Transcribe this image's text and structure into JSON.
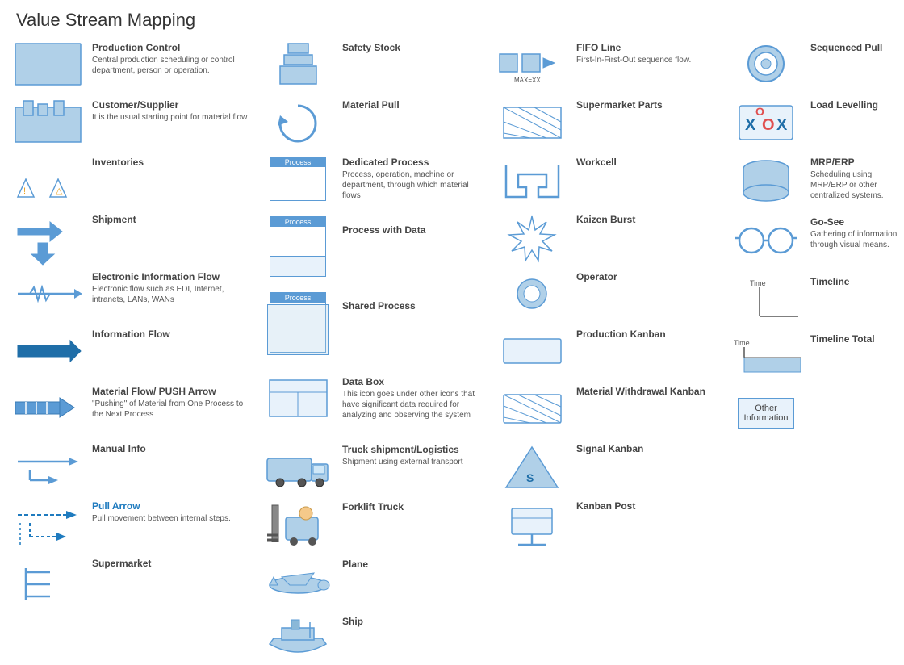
{
  "title": "Value Stream Mapping",
  "col1": {
    "items": [
      {
        "id": "production-control",
        "label": "Production Control",
        "desc": "Central production scheduling or control department, person or operation.",
        "icon": "production-control"
      },
      {
        "id": "customer-supplier",
        "label": "Customer/Supplier",
        "desc": "It is the usual starting point for material flow",
        "icon": "customer-supplier"
      },
      {
        "id": "inventories",
        "label": "Inventories",
        "desc": "",
        "icon": "inventories"
      },
      {
        "id": "shipment",
        "label": "Shipment",
        "desc": "",
        "icon": "shipment"
      },
      {
        "id": "electronic-info",
        "label": "Electronic Information Flow",
        "desc": "Electronic flow such as EDI, Internet, intranets, LANs, WANs",
        "icon": "electronic-info"
      },
      {
        "id": "information-flow",
        "label": "Information Flow",
        "desc": "",
        "icon": "information-flow"
      },
      {
        "id": "material-flow",
        "label": "Material Flow/ PUSH Arrow",
        "desc": "\"Pushing\" of Material from One Process to the Next Process",
        "icon": "material-flow"
      },
      {
        "id": "manual-info",
        "label": "Manual Info",
        "desc": "",
        "icon": "manual-info"
      },
      {
        "id": "pull-arrow",
        "label": "Pull Arrow",
        "desc": "Pull movement between internal steps.",
        "icon": "pull-arrow"
      },
      {
        "id": "supermarket",
        "label": "Supermarket",
        "desc": "",
        "icon": "supermarket"
      }
    ]
  },
  "col2": {
    "items": [
      {
        "id": "safety-stock",
        "label": "Safety Stock",
        "desc": "",
        "icon": "safety-stock"
      },
      {
        "id": "material-pull",
        "label": "Material Pull",
        "desc": "",
        "icon": "material-pull"
      },
      {
        "id": "dedicated-process",
        "label": "Dedicated Process",
        "desc": "Process, operation, machine or department, through which material flows",
        "icon": "dedicated-process"
      },
      {
        "id": "process-with-data",
        "label": "Process with Data",
        "desc": "",
        "icon": "process-with-data"
      },
      {
        "id": "shared-process",
        "label": "Shared Process",
        "desc": "",
        "icon": "shared-process"
      },
      {
        "id": "data-box",
        "label": "Data Box",
        "desc": "This icon goes under other icons that have significant data required for analyzing and observing the system",
        "icon": "data-box"
      },
      {
        "id": "truck-shipment",
        "label": "Truck shipment/Logistics",
        "desc": "Shipment using external transport",
        "icon": "truck"
      },
      {
        "id": "forklift",
        "label": "Forklift Truck",
        "desc": "",
        "icon": "forklift"
      },
      {
        "id": "plane",
        "label": "Plane",
        "desc": "",
        "icon": "plane"
      },
      {
        "id": "ship",
        "label": "Ship",
        "desc": "",
        "icon": "ship"
      }
    ]
  },
  "col3": {
    "items": [
      {
        "id": "fifo-line",
        "label": "FIFO Line",
        "desc": "First-In-First-Out sequence flow.",
        "sub": "MAX=XX",
        "icon": "fifo"
      },
      {
        "id": "supermarket-parts",
        "label": "Supermarket Parts",
        "desc": "",
        "icon": "supermarket-parts"
      },
      {
        "id": "workcell",
        "label": "Workcell",
        "desc": "",
        "icon": "workcell"
      },
      {
        "id": "kaizen-burst",
        "label": "Kaizen Burst",
        "desc": "",
        "icon": "kaizen-burst"
      },
      {
        "id": "operator",
        "label": "Operator",
        "desc": "",
        "icon": "operator"
      },
      {
        "id": "production-kanban",
        "label": "Production Kanban",
        "desc": "",
        "icon": "production-kanban"
      },
      {
        "id": "material-withdrawal",
        "label": "Material Withdrawal Kanban",
        "desc": "",
        "icon": "material-withdrawal"
      },
      {
        "id": "signal-kanban",
        "label": "Signal Kanban",
        "desc": "",
        "icon": "signal-kanban"
      },
      {
        "id": "kanban-post",
        "label": "Kanban Post",
        "desc": "",
        "icon": "kanban-post"
      }
    ]
  },
  "col4": {
    "items": [
      {
        "id": "sequenced-pull",
        "label": "Sequenced Pull",
        "desc": "",
        "icon": "sequenced-pull"
      },
      {
        "id": "load-levelling",
        "label": "Load Levelling",
        "desc": "",
        "icon": "load-levelling"
      },
      {
        "id": "mrp-erp",
        "label": "MRP/ERP",
        "desc": "Scheduling using MRP/ERP or other centralized systems.",
        "icon": "mrp-erp"
      },
      {
        "id": "go-see",
        "label": "Go-See",
        "desc": "Gathering of information through visual means.",
        "icon": "go-see"
      },
      {
        "id": "timeline",
        "label": "Timeline",
        "desc": "",
        "icon": "timeline"
      },
      {
        "id": "timeline-total",
        "label": "Timeline Total",
        "desc": "",
        "icon": "timeline-total"
      },
      {
        "id": "other-information",
        "label": "Other Information",
        "desc": "",
        "icon": "other-information"
      }
    ]
  }
}
